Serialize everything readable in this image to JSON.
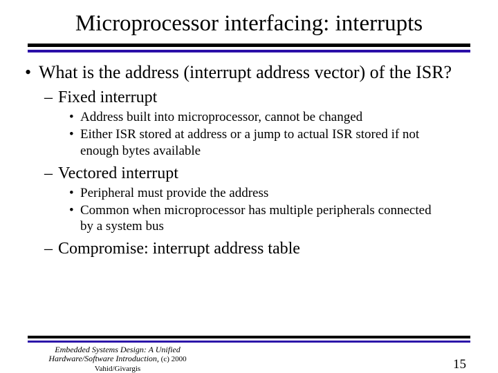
{
  "title": "Microprocessor interfacing: interrupts",
  "bullets": {
    "main": "What is the address (interrupt address vector) of the ISR?",
    "sub": [
      {
        "label": "Fixed interrupt",
        "items": [
          "Address built into microprocessor, cannot be changed",
          "Either ISR stored at address or a jump to actual ISR stored if not enough bytes available"
        ]
      },
      {
        "label": "Vectored interrupt",
        "items": [
          "Peripheral must provide the address",
          "Common when microprocessor has multiple peripherals connected by a system bus"
        ]
      },
      {
        "label": "Compromise: interrupt address table",
        "items": []
      }
    ]
  },
  "footer": {
    "book_line1": "Embedded Systems Design: A Unified",
    "book_line2_italic": "Hardware/Software Introduction,",
    "book_line2_roman": " (c) 2000 Vahid/Givargis",
    "page": "15"
  }
}
